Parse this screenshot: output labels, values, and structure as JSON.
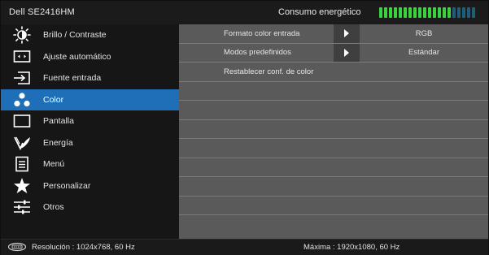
{
  "header": {
    "model": "Dell SE2416HM",
    "power_label": "Consumo energético",
    "power_level": 0.75,
    "power_segments": 20
  },
  "colors": {
    "active": "#1f6fb8",
    "meter_on": "#3cd23c",
    "meter_off": "#1e5e7a",
    "panel": "#5a5a5a"
  },
  "sidebar": {
    "items": [
      {
        "label": "Brillo / Contraste",
        "icon": "brightness-icon"
      },
      {
        "label": "Ajuste  automático",
        "icon": "auto-adjust-icon"
      },
      {
        "label": "Fuente entrada",
        "icon": "input-source-icon"
      },
      {
        "label": "Color",
        "icon": "color-icon",
        "active": true
      },
      {
        "label": "Pantalla",
        "icon": "display-icon"
      },
      {
        "label": "Energía",
        "icon": "energy-icon"
      },
      {
        "label": "Menú",
        "icon": "menu-icon"
      },
      {
        "label": "Personalizar",
        "icon": "star-icon"
      },
      {
        "label": "Otros",
        "icon": "others-icon"
      }
    ]
  },
  "panel": {
    "rows": [
      {
        "label": "Formato color entrada",
        "value": "RGB",
        "arrow": true
      },
      {
        "label": "Modos predefinidos",
        "value": "Estándar",
        "arrow": true
      },
      {
        "label": "Restablecer conf. de color"
      }
    ]
  },
  "footer": {
    "resolution": "Resolución  : 1024x768, 60 Hz",
    "maximum": "Máxima : 1920x1080, 60 Hz"
  }
}
